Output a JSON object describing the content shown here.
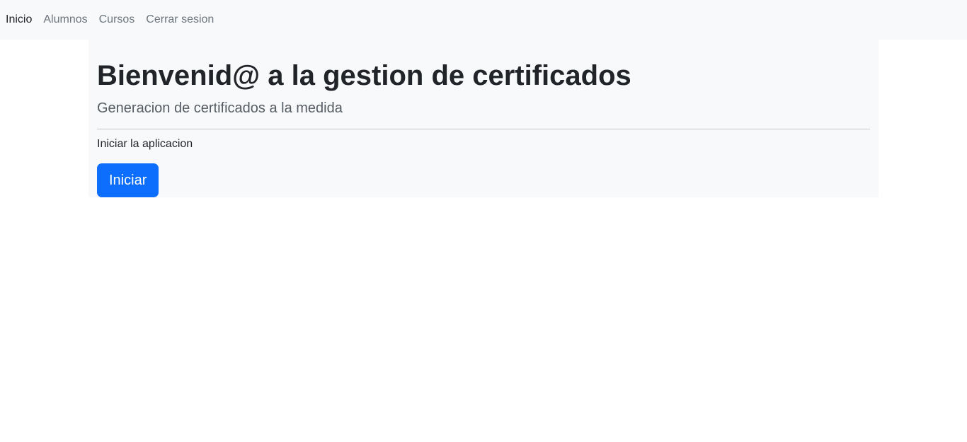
{
  "navbar": {
    "items": [
      {
        "label": "Inicio",
        "active": true
      },
      {
        "label": "Alumnos",
        "active": false
      },
      {
        "label": "Cursos",
        "active": false
      },
      {
        "label": "Cerrar sesion",
        "active": false
      }
    ]
  },
  "jumbotron": {
    "title": "Bienvenid@ a la gestion de certificados",
    "lead": "Generacion de certificados a la medida",
    "text": "Iniciar la aplicacion",
    "button_label": "Iniciar"
  },
  "colors": {
    "navbar_bg": "#f8f9fa",
    "primary": "#0d6efd",
    "text": "#212529",
    "muted": "#6c757d"
  }
}
